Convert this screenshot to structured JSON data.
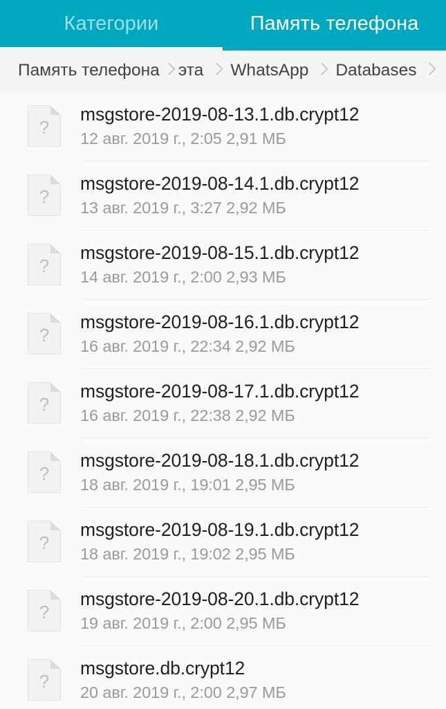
{
  "theme": {
    "accent": "#00a8bf",
    "tabbar_bg": "#00a8bf",
    "breadcrumb_bg": "#f5f5f6",
    "list_bg": "#fafafa",
    "divider": "#e8e8e8",
    "primary_text": "#1f1f1f",
    "secondary_text": "#9a9a9a",
    "breadcrumb_text": "#424242",
    "icon_gray": "#bdbdbd"
  },
  "tabs": [
    {
      "id": "categories",
      "label": "Категории",
      "active": false
    },
    {
      "id": "phone-storage",
      "label": "Память телефона",
      "active": true
    }
  ],
  "breadcrumb": {
    "items": [
      {
        "label": "Память телефона"
      },
      {
        "label": "эта"
      },
      {
        "label": "WhatsApp"
      },
      {
        "label": "Databases"
      }
    ],
    "separator": "chevron-right-icon",
    "trailing_separator": true
  },
  "file_list": {
    "icon": "unknown-file-icon",
    "icon_glyph": "?",
    "items": [
      {
        "name": "msgstore-2019-08-13.1.db.crypt12",
        "meta": "12 авг. 2019 г., 2:05 2,91 МБ",
        "date": "12 авг. 2019 г.",
        "time": "2:05",
        "size": "2,91 МБ"
      },
      {
        "name": "msgstore-2019-08-14.1.db.crypt12",
        "meta": "13 авг. 2019 г., 3:27 2,92 МБ",
        "date": "13 авг. 2019 г.",
        "time": "3:27",
        "size": "2,92 МБ"
      },
      {
        "name": "msgstore-2019-08-15.1.db.crypt12",
        "meta": "14 авг. 2019 г., 2:00 2,93 МБ",
        "date": "14 авг. 2019 г.",
        "time": "2:00",
        "size": "2,93 МБ"
      },
      {
        "name": "msgstore-2019-08-16.1.db.crypt12",
        "meta": "16 авг. 2019 г., 22:34 2,92 МБ",
        "date": "16 авг. 2019 г.",
        "time": "22:34",
        "size": "2,92 МБ"
      },
      {
        "name": "msgstore-2019-08-17.1.db.crypt12",
        "meta": "16 авг. 2019 г., 22:38 2,92 МБ",
        "date": "16 авг. 2019 г.",
        "time": "22:38",
        "size": "2,92 МБ"
      },
      {
        "name": "msgstore-2019-08-18.1.db.crypt12",
        "meta": "18 авг. 2019 г., 19:01 2,95 МБ",
        "date": "18 авг. 2019 г.",
        "time": "19:01",
        "size": "2,95 МБ"
      },
      {
        "name": "msgstore-2019-08-19.1.db.crypt12",
        "meta": "18 авг. 2019 г., 19:02 2,95 МБ",
        "date": "18 авг. 2019 г.",
        "time": "19:02",
        "size": "2,95 МБ"
      },
      {
        "name": "msgstore-2019-08-20.1.db.crypt12",
        "meta": "19 авг. 2019 г., 2:00 2,95 МБ",
        "date": "19 авг. 2019 г.",
        "time": "2:00",
        "size": "2,95 МБ"
      },
      {
        "name": "msgstore.db.crypt12",
        "meta": "20 авг. 2019 г., 2:00 2,97 МБ",
        "date": "20 авг. 2019 г.",
        "time": "2:00",
        "size": "2,97 МБ"
      }
    ]
  }
}
